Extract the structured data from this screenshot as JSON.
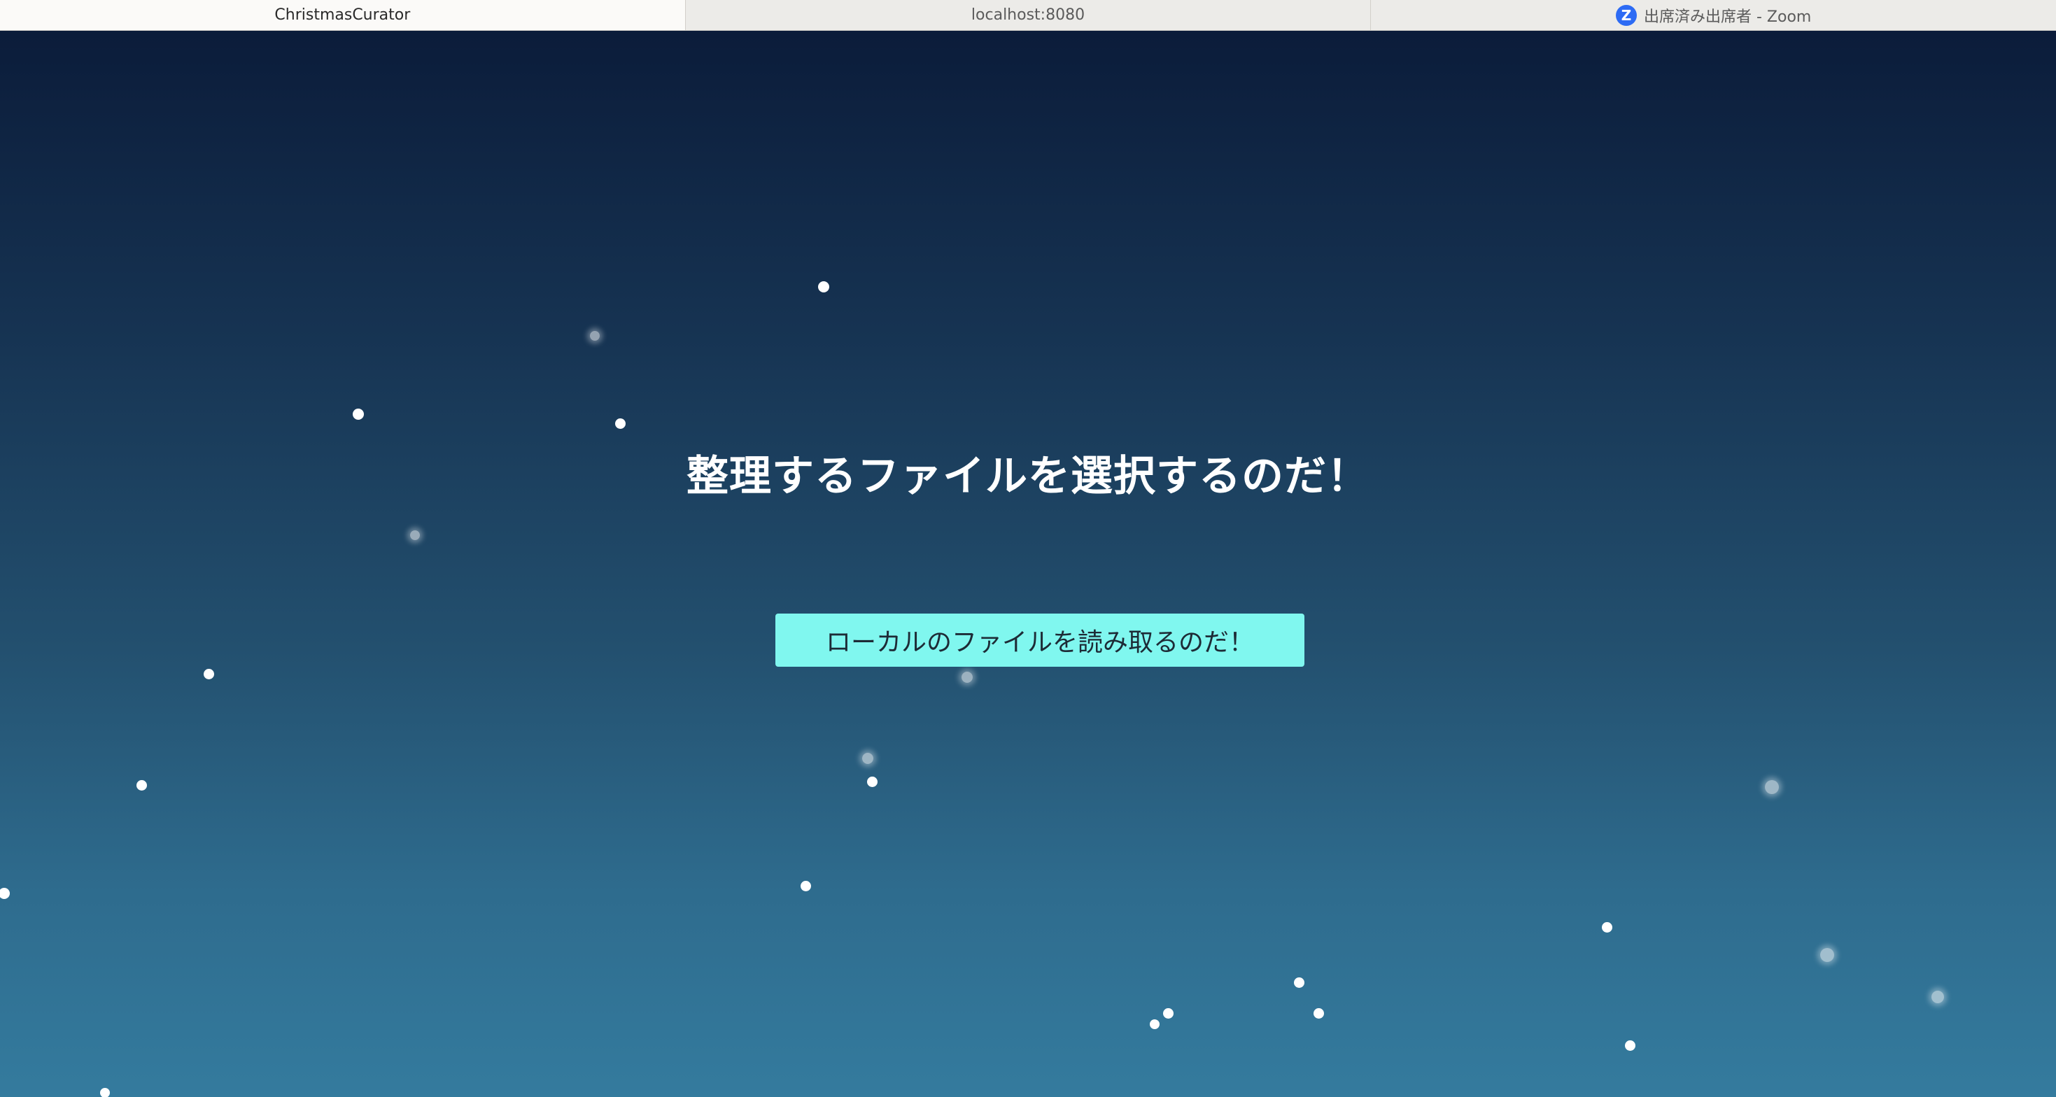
{
  "browser": {
    "tabs": [
      {
        "label": "ChristmasCurator",
        "active": true
      },
      {
        "label": "localhost:8080",
        "active": false
      },
      {
        "label": "出席済み出席者 - Zoom",
        "active": false,
        "icon": "zoom-icon",
        "icon_glyph": "Z"
      }
    ]
  },
  "main": {
    "headline": "整理するファイルを選択するのだ！",
    "read_button_label": "ローカルのファイルを読み取るのだ！"
  },
  "colors": {
    "background_top": "#0b1c3a",
    "background_bottom": "#347b9e",
    "button": "#80f7ef",
    "zoom_brand": "#2d6bf4"
  }
}
